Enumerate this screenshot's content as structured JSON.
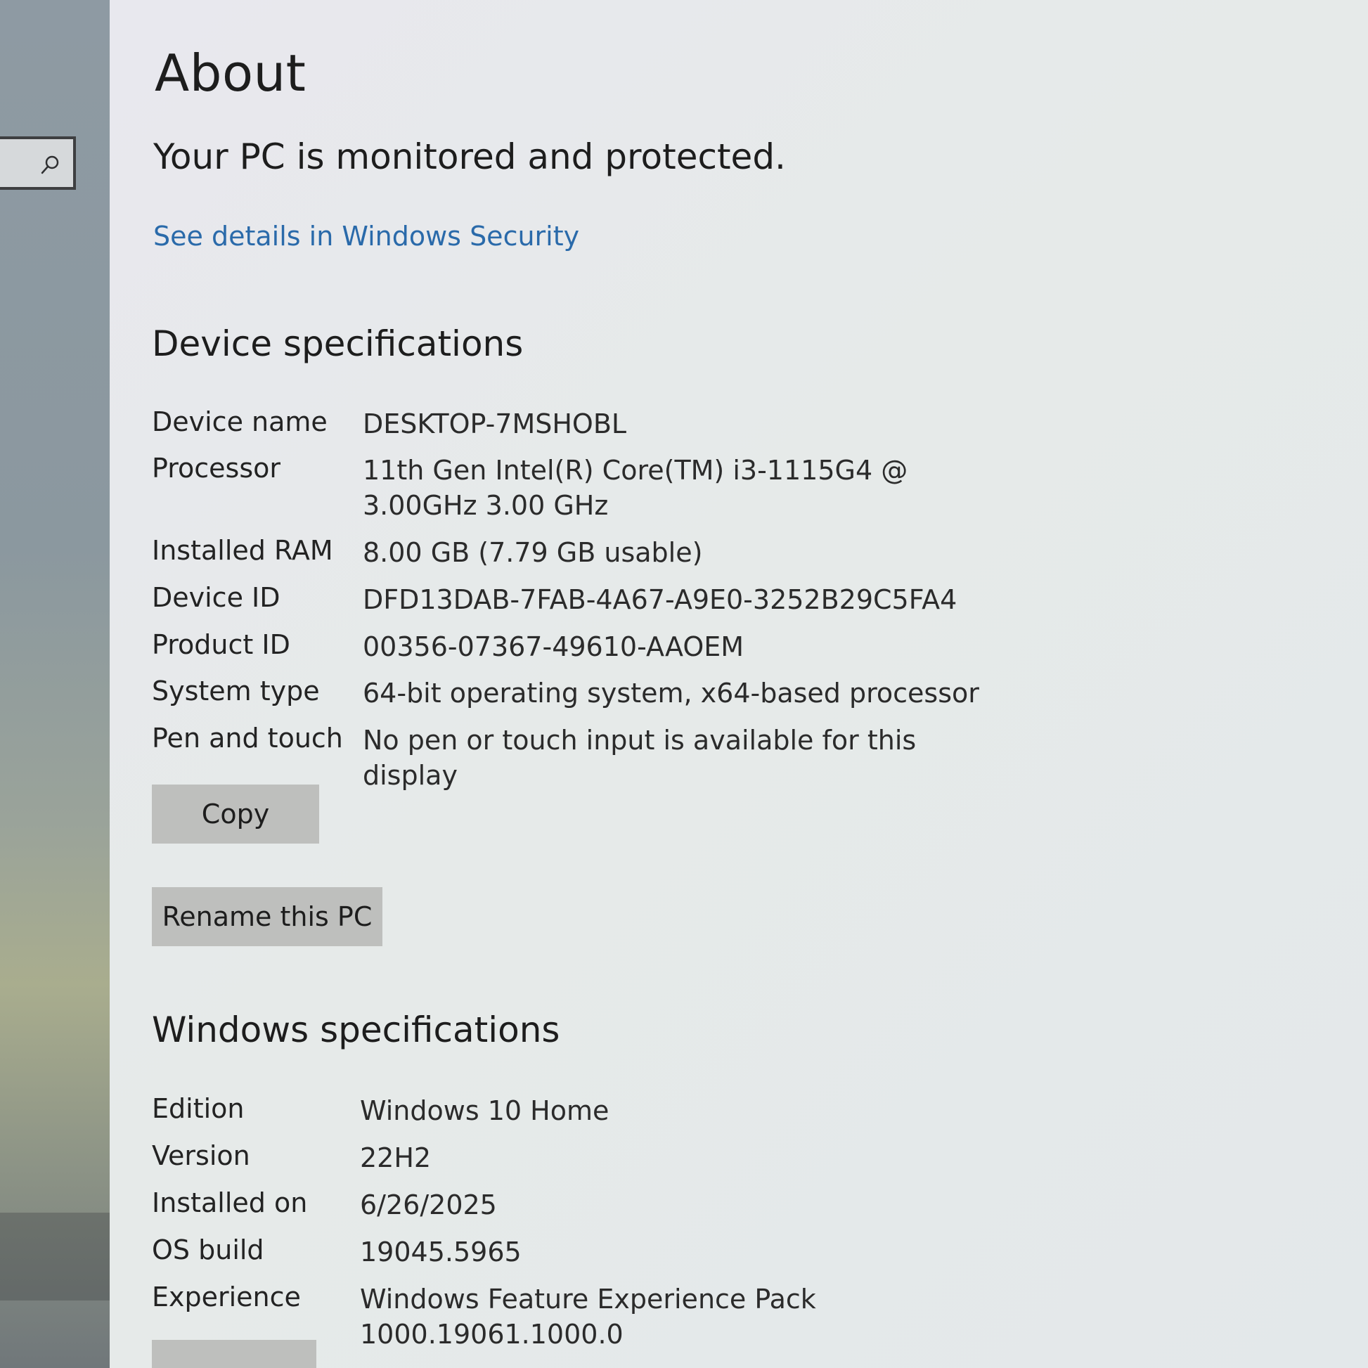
{
  "search": {
    "icon": "search-icon"
  },
  "page": {
    "title": "About",
    "protection_status": "Your PC is monitored and protected.",
    "security_link": "See details in Windows Security"
  },
  "device_specs": {
    "heading": "Device specifications",
    "rows": [
      {
        "label": "Device name",
        "value": "DESKTOP-7MSHOBL"
      },
      {
        "label": "Processor",
        "value": "11th Gen Intel(R) Core(TM) i3-1115G4 @ 3.00GHz   3.00 GHz"
      },
      {
        "label": "Installed RAM",
        "value": "8.00 GB (7.79 GB usable)"
      },
      {
        "label": "Device ID",
        "value": "DFD13DAB-7FAB-4A67-A9E0-3252B29C5FA4"
      },
      {
        "label": "Product ID",
        "value": "00356-07367-49610-AAOEM"
      },
      {
        "label": "System type",
        "value": "64-bit operating system, x64-based processor"
      },
      {
        "label": "Pen and touch",
        "value": "No pen or touch input is available for this display"
      }
    ],
    "copy_label": "Copy",
    "rename_label": "Rename this PC"
  },
  "windows_specs": {
    "heading": "Windows specifications",
    "rows": [
      {
        "label": "Edition",
        "value": "Windows 10 Home"
      },
      {
        "label": "Version",
        "value": "22H2"
      },
      {
        "label": "Installed on",
        "value": "6/26/2025"
      },
      {
        "label": "OS build",
        "value": "19045.5965"
      },
      {
        "label": "Experience",
        "value": "Windows Feature Experience Pack 1000.19061.1000.0"
      }
    ]
  },
  "colors": {
    "link": "#2a6aaa",
    "button_bg": "#bebfbd",
    "text": "#1d1d1d"
  }
}
